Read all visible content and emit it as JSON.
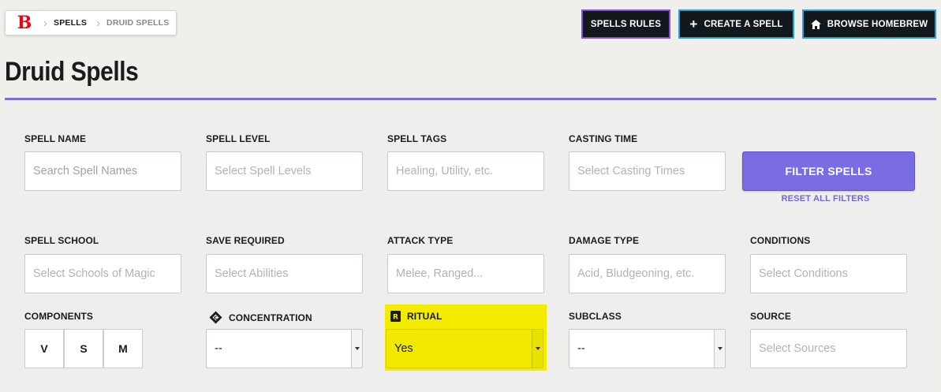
{
  "breadcrumb": {
    "items": [
      "SPELLS",
      "DRUID SPELLS"
    ]
  },
  "top_buttons": {
    "rules": "SPELLS RULES",
    "create": "CREATE A SPELL",
    "browse": "BROWSE HOMEBREW"
  },
  "page_title": "Druid Spells",
  "filters": {
    "spell_name": {
      "label": "SPELL NAME",
      "placeholder": "Search Spell Names"
    },
    "spell_level": {
      "label": "SPELL LEVEL",
      "placeholder": "Select Spell Levels"
    },
    "spell_tags": {
      "label": "SPELL TAGS",
      "placeholder": "Healing, Utility, etc."
    },
    "casting_time": {
      "label": "CASTING TIME",
      "placeholder": "Select Casting Times"
    },
    "spell_school": {
      "label": "SPELL SCHOOL",
      "placeholder": "Select Schools of Magic"
    },
    "save_required": {
      "label": "SAVE REQUIRED",
      "placeholder": "Select Abilities"
    },
    "attack_type": {
      "label": "ATTACK TYPE",
      "placeholder": "Melee, Ranged..."
    },
    "damage_type": {
      "label": "DAMAGE TYPE",
      "placeholder": "Acid, Bludgeoning, etc."
    },
    "conditions": {
      "label": "CONDITIONS",
      "placeholder": "Select Conditions"
    },
    "components": {
      "label": "COMPONENTS",
      "options": [
        "V",
        "S",
        "M"
      ]
    },
    "concentration": {
      "label": "CONCENTRATION",
      "value": "--"
    },
    "ritual": {
      "label": "RITUAL",
      "value": "Yes"
    },
    "subclass": {
      "label": "SUBCLASS",
      "value": "--"
    },
    "source": {
      "label": "SOURCE",
      "placeholder": "Select Sources"
    }
  },
  "actions": {
    "filter": "FILTER SPELLS",
    "reset": "RESET ALL FILTERS"
  },
  "colors": {
    "accent_purple": "#7a6de3",
    "brand_red": "#e40712",
    "highlight_yellow": "#f3ec00",
    "button_dark": "#12181c",
    "button_border_blue": "#2d9fd8"
  },
  "icons": {
    "logo": "dndbeyond-logo",
    "breadcrumb_sep": "chevron-right-icon",
    "create": "plus-icon",
    "browse": "home-icon",
    "concentration": "concentration-icon",
    "ritual": "ritual-icon"
  }
}
